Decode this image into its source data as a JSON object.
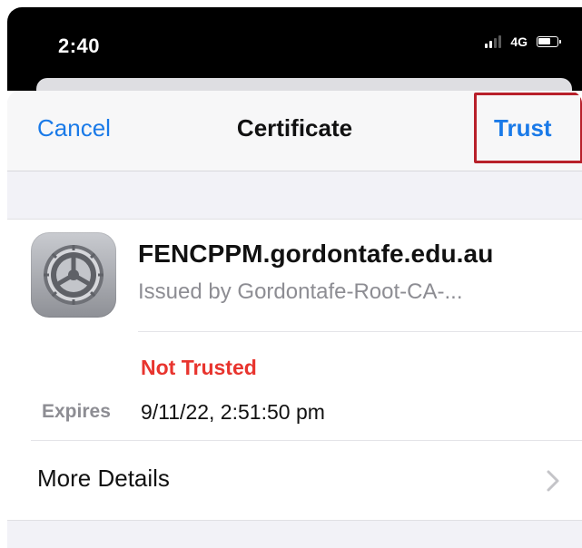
{
  "status_bar": {
    "time": "2:40",
    "network": "4G"
  },
  "navbar": {
    "cancel_label": "Cancel",
    "title": "Certificate",
    "trust_label": "Trust"
  },
  "certificate": {
    "icon": "settings-gear-icon",
    "name": "FENCPPM.gordontafe.edu.au",
    "issuer": "Issued by Gordontafe-Root-CA-...",
    "status": "Not Trusted",
    "expires_label": "Expires",
    "expires_value": "9/11/22, 2:51:50 pm",
    "more_details_label": "More Details"
  },
  "colors": {
    "accent": "#1a7ae8",
    "warning": "#e8342e",
    "highlight_box": "#b8202a"
  }
}
